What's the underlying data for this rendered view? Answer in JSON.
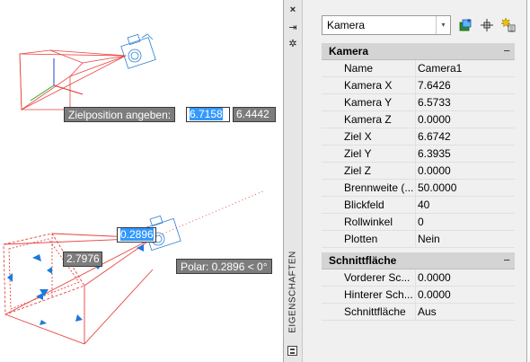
{
  "viewport": {
    "tooltip_target": {
      "prompt": "Zielposition angeben:",
      "value_selected": "6.7158",
      "value_second": "6.4442"
    },
    "tooltip_lens": {
      "value_selected": "0.2896",
      "distance": "2.7976",
      "polar": "Polar: 0.2896 < 0°"
    }
  },
  "palette": {
    "strip": {
      "close_icon": "×",
      "autohide_icon": "⇥",
      "settings_icon": "✲",
      "title": "EIGENSCHAFTEN"
    },
    "selector": {
      "value": "Kamera",
      "arrow": "▾"
    },
    "sections": [
      {
        "title": "Kamera",
        "collapse": "−",
        "rows": [
          {
            "label": "Name",
            "value": "Camera1"
          },
          {
            "label": "Kamera X",
            "value": "7.6426"
          },
          {
            "label": "Kamera Y",
            "value": "6.5733"
          },
          {
            "label": "Kamera Z",
            "value": "0.0000"
          },
          {
            "label": "Ziel X",
            "value": "6.6742"
          },
          {
            "label": "Ziel Y",
            "value": "6.3935"
          },
          {
            "label": "Ziel Z",
            "value": "0.0000"
          },
          {
            "label": "Brennweite (...",
            "value": "50.0000"
          },
          {
            "label": "Blickfeld",
            "value": "40"
          },
          {
            "label": "Rollwinkel",
            "value": "0"
          },
          {
            "label": "Plotten",
            "value": "Nein"
          }
        ]
      },
      {
        "title": "Schnittfläche",
        "collapse": "−",
        "rows": [
          {
            "label": "Vorderer Sc...",
            "value": "0.0000"
          },
          {
            "label": "Hinterer Sch...",
            "value": "0.0000"
          },
          {
            "label": "Schnittfläche",
            "value": "Aus"
          }
        ]
      }
    ]
  },
  "colors": {
    "frustum": "#e8413c",
    "camera_glyph": "#2a7fd0",
    "grip": "#1e78dc",
    "axis_x": "#e03030",
    "axis_y": "#22aa22",
    "axis_z": "#2040cc"
  }
}
